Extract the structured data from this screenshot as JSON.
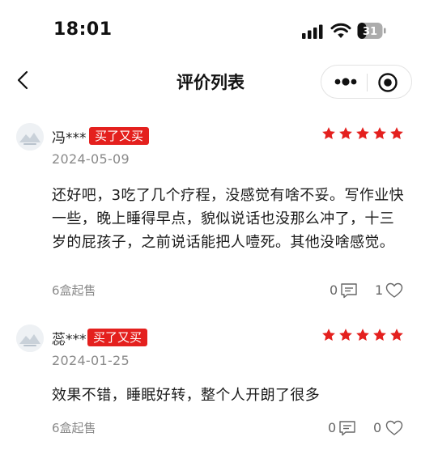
{
  "status_bar": {
    "time": "18:01",
    "battery_level": "31",
    "icons": [
      "cellular-signal-icon",
      "wifi-icon",
      "battery-icon"
    ]
  },
  "nav": {
    "title": "评价列表",
    "icons": [
      "back-arrow-icon",
      "more-dots-icon",
      "close-target-icon"
    ]
  },
  "colors": {
    "accent_red": "#e4201e",
    "muted_text": "#8a8a8a"
  },
  "reviews": [
    {
      "name": "冯***",
      "badge": "买了又买",
      "rating": 5,
      "date": "2024-05-09",
      "content": "还好吧，3吃了几个疗程，没感觉有啥不妥。写作业快一些，晚上睡得早点，貌似说话也没那么冲了，十三岁的屁孩子，之前说话能把人噎死。其他没啥感觉。",
      "spec": "6盒起售",
      "comment_count": "0",
      "like_count": "1"
    },
    {
      "name": "蕊***",
      "badge": "买了又买",
      "rating": 5,
      "date": "2024-01-25",
      "content": "效果不错，睡眠好转，整个人开朗了很多",
      "spec": "6盒起售",
      "comment_count": "0",
      "like_count": "0"
    }
  ]
}
